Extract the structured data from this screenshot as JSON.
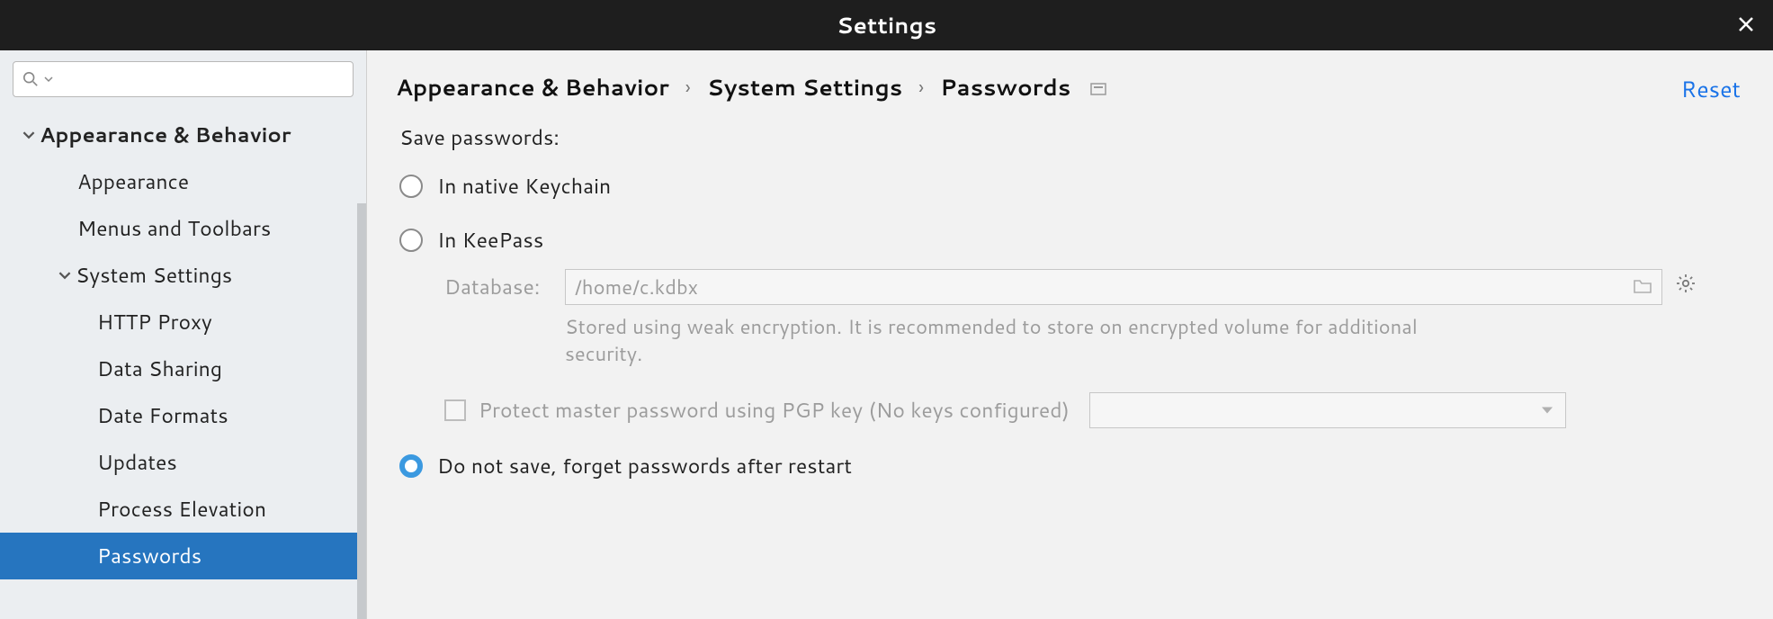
{
  "window": {
    "title": "Settings"
  },
  "sidebar": {
    "search_placeholder": "",
    "items": [
      {
        "label": "Appearance & Behavior",
        "level": 0,
        "arrow": "down"
      },
      {
        "label": "Appearance",
        "level": 1
      },
      {
        "label": "Menus and Toolbars",
        "level": 1
      },
      {
        "label": "System Settings",
        "level": 1,
        "arrow": "down"
      },
      {
        "label": "HTTP Proxy",
        "level": 2
      },
      {
        "label": "Data Sharing",
        "level": 2
      },
      {
        "label": "Date Formats",
        "level": 2
      },
      {
        "label": "Updates",
        "level": 2
      },
      {
        "label": "Process Elevation",
        "level": 2
      },
      {
        "label": "Passwords",
        "level": 2,
        "selected": true
      }
    ]
  },
  "breadcrumb": {
    "parts": [
      "Appearance & Behavior",
      "System Settings",
      "Passwords"
    ],
    "reset": "Reset"
  },
  "form": {
    "section_label": "Save passwords:",
    "option_native": "In native Keychain",
    "option_keepass": "In KeePass",
    "database_label": "Database:",
    "database_value": "/home/c.kdbx",
    "hint": "Stored using weak encryption. It is recommended to store on encrypted volume for additional security.",
    "pgp_label": "Protect master password using PGP key (No keys configured)",
    "option_do_not_save": "Do not save, forget passwords after restart",
    "selected": "do_not_save"
  }
}
